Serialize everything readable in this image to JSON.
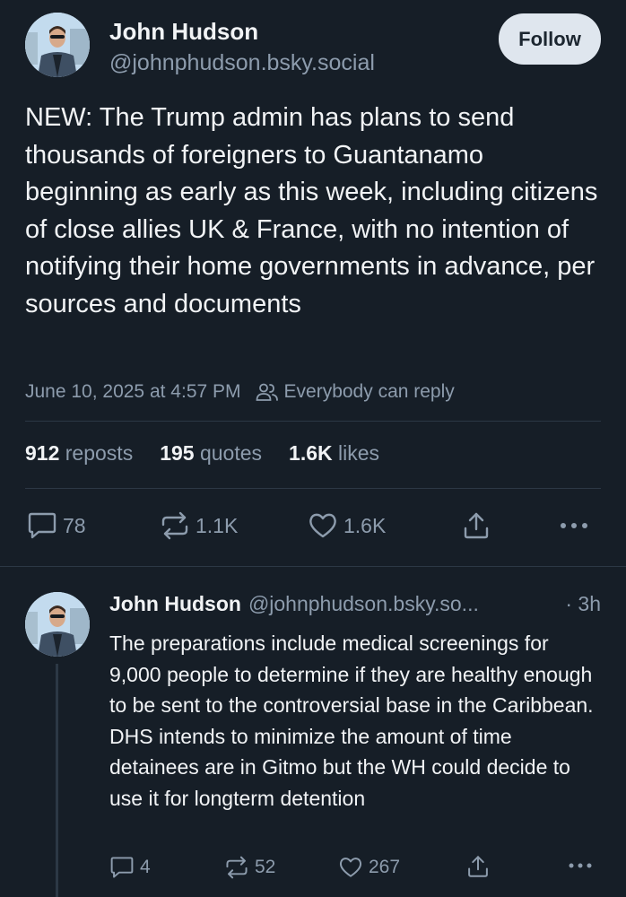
{
  "post": {
    "author_name": "John Hudson",
    "handle": "@johnphudson.bsky.social",
    "follow_label": "Follow",
    "text": "NEW: The Trump admin has plans to send thousands of foreigners to Guantanamo beginning as early as this week, including citizens of close allies UK & France, with no intention of notifying their home governments in advance, per sources and documents",
    "timestamp": "June 10, 2025 at 4:57 PM",
    "reply_setting": "Everybody can reply",
    "stats": {
      "reposts_count": "912",
      "reposts_label": "reposts",
      "quotes_count": "195",
      "quotes_label": "quotes",
      "likes_count": "1.6K",
      "likes_label": "likes"
    },
    "actions": {
      "reply_count": "78",
      "repost_count": "1.1K",
      "like_count": "1.6K"
    }
  },
  "reply": {
    "author_name": "John Hudson",
    "handle": "@johnphudson.bsky.so...",
    "time": "· 3h",
    "text": "The preparations include medical screenings for 9,000 people to determine if they are healthy enough to be sent to the controversial base in the Caribbean. DHS intends to minimize the amount of time detainees are in Gitmo but the WH could decide to use it for longterm detention",
    "actions": {
      "reply_count": "4",
      "repost_count": "52",
      "like_count": "267"
    }
  },
  "icons": [
    "people-icon",
    "reply-icon",
    "repost-icon",
    "like-icon",
    "share-icon",
    "more-icon"
  ],
  "colors": {
    "background": "#161e27",
    "muted": "#8d9cad",
    "follow_bg": "#dfe6ee"
  }
}
